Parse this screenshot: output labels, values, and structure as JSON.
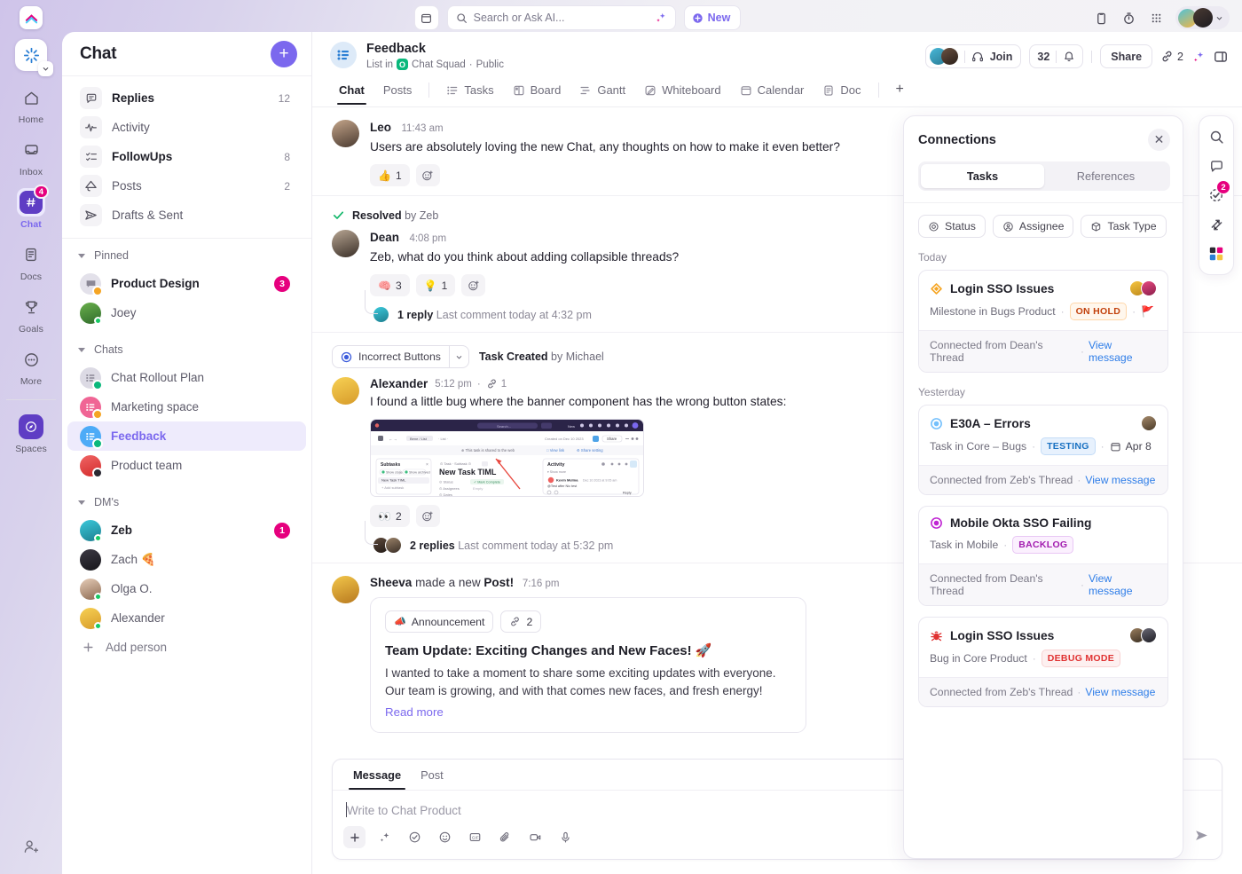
{
  "topbar": {
    "search_placeholder": "Search or Ask AI...",
    "new_label": "New",
    "icons": [
      "calendar-icon",
      "ai-sparkle-icon",
      "clipboard-icon",
      "timer-icon",
      "apps-grid-icon"
    ]
  },
  "rail": {
    "items": [
      {
        "label": "Home",
        "icon": "home-icon",
        "badge": ""
      },
      {
        "label": "Inbox",
        "icon": "inbox-icon",
        "badge": ""
      },
      {
        "label": "Chat",
        "icon": "hash-icon",
        "badge": "4"
      },
      {
        "label": "Docs",
        "icon": "doc-icon",
        "badge": ""
      },
      {
        "label": "Goals",
        "icon": "trophy-icon",
        "badge": ""
      },
      {
        "label": "More",
        "icon": "ellipsis-icon",
        "badge": ""
      }
    ],
    "spaces_label": "Spaces",
    "invite_icon": "add-person-icon"
  },
  "sidebar": {
    "title": "Chat",
    "add_button": "+",
    "nav": [
      {
        "label": "Replies",
        "count": "12",
        "bold": true,
        "icon": "replies-icon"
      },
      {
        "label": "Activity",
        "count": "",
        "bold": false,
        "icon": "activity-icon"
      },
      {
        "label": "FollowUps",
        "count": "8",
        "bold": true,
        "icon": "followups-icon"
      },
      {
        "label": "Posts",
        "count": "2",
        "bold": false,
        "icon": "posts-icon"
      },
      {
        "label": "Drafts & Sent",
        "count": "",
        "bold": false,
        "icon": "send-icon"
      }
    ],
    "groups": [
      {
        "label": "Pinned",
        "items": [
          {
            "label": "Product Design",
            "badge": "3",
            "bold": true,
            "avatar_color": "#e3e1ea",
            "kind": "channel",
            "corner": "#f5a524"
          },
          {
            "label": "Joey",
            "badge": "",
            "bold": false,
            "avatar_color": "#6ab04c",
            "kind": "person",
            "status": "#17c964"
          }
        ]
      },
      {
        "label": "Chats",
        "items": [
          {
            "label": "Chat Rollout Plan",
            "badge": "",
            "bold": false,
            "avatar_color": "#dcdae4",
            "kind": "list",
            "corner": "#0ab87c"
          },
          {
            "label": "Marketing space",
            "badge": "",
            "bold": false,
            "avatar_color": "#f06595",
            "kind": "list",
            "corner": "#f5a524"
          },
          {
            "label": "Feedback",
            "badge": "",
            "bold": false,
            "active": true,
            "avatar_color": "#4dabf7",
            "kind": "list",
            "corner": "#0ab87c"
          },
          {
            "label": "Product team",
            "badge": "",
            "bold": false,
            "avatar_color": "#f03e3e",
            "kind": "list",
            "corner": "#2b2a33"
          }
        ]
      },
      {
        "label": "DM's",
        "items": [
          {
            "label": "Zeb",
            "badge": "1",
            "bold": true,
            "avatar_color": "#3bc9db",
            "kind": "person",
            "status": "#17c964"
          },
          {
            "label": "Zach 🍕",
            "badge": "",
            "bold": false,
            "avatar_color": "#2b2a33",
            "kind": "person",
            "status": ""
          },
          {
            "label": "Olga O.",
            "badge": "",
            "bold": false,
            "avatar_color": "#d9c3b0",
            "kind": "person",
            "status": "#17c964"
          },
          {
            "label": "Alexander",
            "badge": "",
            "bold": false,
            "avatar_color": "#f5c542",
            "kind": "person",
            "status": "#17c964"
          }
        ]
      }
    ],
    "add_person_label": "Add person"
  },
  "main_header": {
    "title": "Feedback",
    "subtitle_prefix": "List in",
    "squad": "Chat Squad",
    "visibility": "Public",
    "join_label": "Join",
    "member_count": "32",
    "share_label": "Share",
    "link_count": "2",
    "tabs": [
      {
        "label": "Chat",
        "icon": "",
        "active": true
      },
      {
        "label": "Posts",
        "icon": "",
        "active": false
      },
      {
        "label": "Tasks",
        "icon": "list-icon",
        "active": false
      },
      {
        "label": "Board",
        "icon": "board-icon",
        "active": false
      },
      {
        "label": "Gantt",
        "icon": "gantt-icon",
        "active": false
      },
      {
        "label": "Whiteboard",
        "icon": "whiteboard-icon",
        "active": false
      },
      {
        "label": "Calendar",
        "icon": "calendar-icon",
        "active": false
      },
      {
        "label": "Doc",
        "icon": "doc-icon",
        "active": false
      },
      {
        "label": "+",
        "icon": "plus-icon",
        "active": false
      }
    ]
  },
  "messages": {
    "m1": {
      "name": "Leo",
      "time": "11:43 am",
      "text": "Users are absolutely loving the new Chat, any thoughts on how to make it even better?",
      "reaction_emoji": "👍",
      "reaction_count": "1"
    },
    "m2": {
      "resolved_label": "Resolved",
      "resolved_by": "by Zeb",
      "name": "Dean",
      "time": "4:08 pm",
      "text": "Zeb, what do you think about adding collapsible threads?",
      "rx1_emoji": "🧠",
      "rx1_count": "3",
      "rx2_emoji": "💡",
      "rx2_count": "1",
      "thread_count": "1 reply",
      "thread_meta": "Last comment today at 4:32 pm"
    },
    "m3": {
      "task_chip_label": "Incorrect Buttons",
      "task_meta_bold": "Task Created",
      "task_meta_rest": "by Michael",
      "name": "Alexander",
      "time": "5:12 pm",
      "link_count": "1",
      "text": "I found a little bug where the banner component has the wrong button states:",
      "rx_emoji": "👀",
      "rx_count": "2",
      "thread_count": "2 replies",
      "thread_meta": "Last comment today at 5:32 pm",
      "embed_alt": "screenshot-of-task-view"
    },
    "m4": {
      "author": "Sheeva",
      "action_prefix": "made a new",
      "action_bold": "Post!",
      "time": "7:16 pm",
      "tag_label": "Announcement",
      "tag_emoji": "📣",
      "link_count": "2",
      "title": "Team Update: Exciting Changes and New Faces! 🚀",
      "body": "I wanted to take a moment to share some exciting updates with everyone. Our team is growing, and with that comes new faces, and fresh energy!",
      "read_more": "Read more"
    }
  },
  "composer": {
    "tabs": [
      "Message",
      "Post"
    ],
    "active_tab": "Message",
    "placeholder": "Write to Chat Product",
    "tools": [
      "plus-icon",
      "ai-sparkle-icon",
      "checkbox-icon",
      "emoji-icon",
      "gif-icon",
      "attach-icon",
      "video-icon",
      "mic-icon"
    ],
    "send_icon": "send-icon"
  },
  "connections": {
    "title": "Connections",
    "close_icon": "close-icon",
    "tabs": [
      {
        "label": "Tasks",
        "active": true
      },
      {
        "label": "References",
        "active": false
      }
    ],
    "filters": [
      {
        "label": "Status",
        "icon": "target-icon"
      },
      {
        "label": "Assignee",
        "icon": "user-circle-icon"
      },
      {
        "label": "Task Type",
        "icon": "cube-icon"
      }
    ],
    "groups": [
      {
        "day": "Today",
        "cards": [
          {
            "title": "Login SSO Issues",
            "type_icon": "milestone-icon",
            "type_color": "#f5a524",
            "subtitle": "Milestone in Bugs Product",
            "status": "ON HOLD",
            "status_color": "#c2410c",
            "status_bg": "#fff7ed",
            "status_border": "#fed7aa",
            "flag": "🚩",
            "date": "",
            "avatars": [
              "#f5c542",
              "#e64980"
            ],
            "footer": "Connected from Dean's Thread",
            "footer_link": "View message"
          }
        ]
      },
      {
        "day": "Yesterday",
        "cards": [
          {
            "title": "E30A – Errors",
            "type_icon": "task-circle-icon",
            "type_color": "#74c0fc",
            "subtitle": "Task in Core – Bugs",
            "status": "TESTING",
            "status_color": "#1971c2",
            "status_bg": "#e7f1fd",
            "status_border": "#c4dcf7",
            "flag": "",
            "date": "Apr 8",
            "avatars": [
              "#8d7256"
            ],
            "footer": "Connected from Zeb's Thread",
            "footer_link": "View message"
          },
          {
            "title": "Mobile Okta SSO Failing",
            "type_icon": "task-circle-icon",
            "type_color": "#c026d3",
            "subtitle": "Task in Mobile",
            "status": "BACKLOG",
            "status_color": "#a21caf",
            "status_bg": "#fbf0fe",
            "status_border": "#e9c7f5",
            "flag": "",
            "date": "",
            "avatars": [],
            "footer": "Connected from Dean's Thread",
            "footer_link": "View message"
          },
          {
            "title": "Login SSO Issues",
            "type_icon": "bug-icon",
            "type_color": "#e03131",
            "subtitle": "Bug in Core Product",
            "status": "DEBUG MODE",
            "status_color": "#e03131",
            "status_bg": "#fdf0f0",
            "status_border": "#f8d3d3",
            "flag": "",
            "date": "",
            "avatars": [
              "#8d7256",
              "#2b2a33"
            ],
            "footer": "Connected from Zeb's Thread",
            "footer_link": "View message"
          }
        ]
      }
    ]
  },
  "right_rail": {
    "icons": [
      {
        "name": "search-icon",
        "badge": ""
      },
      {
        "name": "comment-icon",
        "badge": ""
      },
      {
        "name": "task-check-icon",
        "badge": "2"
      },
      {
        "name": "connections-arrows-icon",
        "badge": ""
      },
      {
        "name": "apps-color-icon",
        "badge": ""
      }
    ]
  },
  "colors": {
    "accent": "#7b68ee",
    "badge_pink": "#e6007e",
    "link_blue": "#2f7ee8"
  }
}
